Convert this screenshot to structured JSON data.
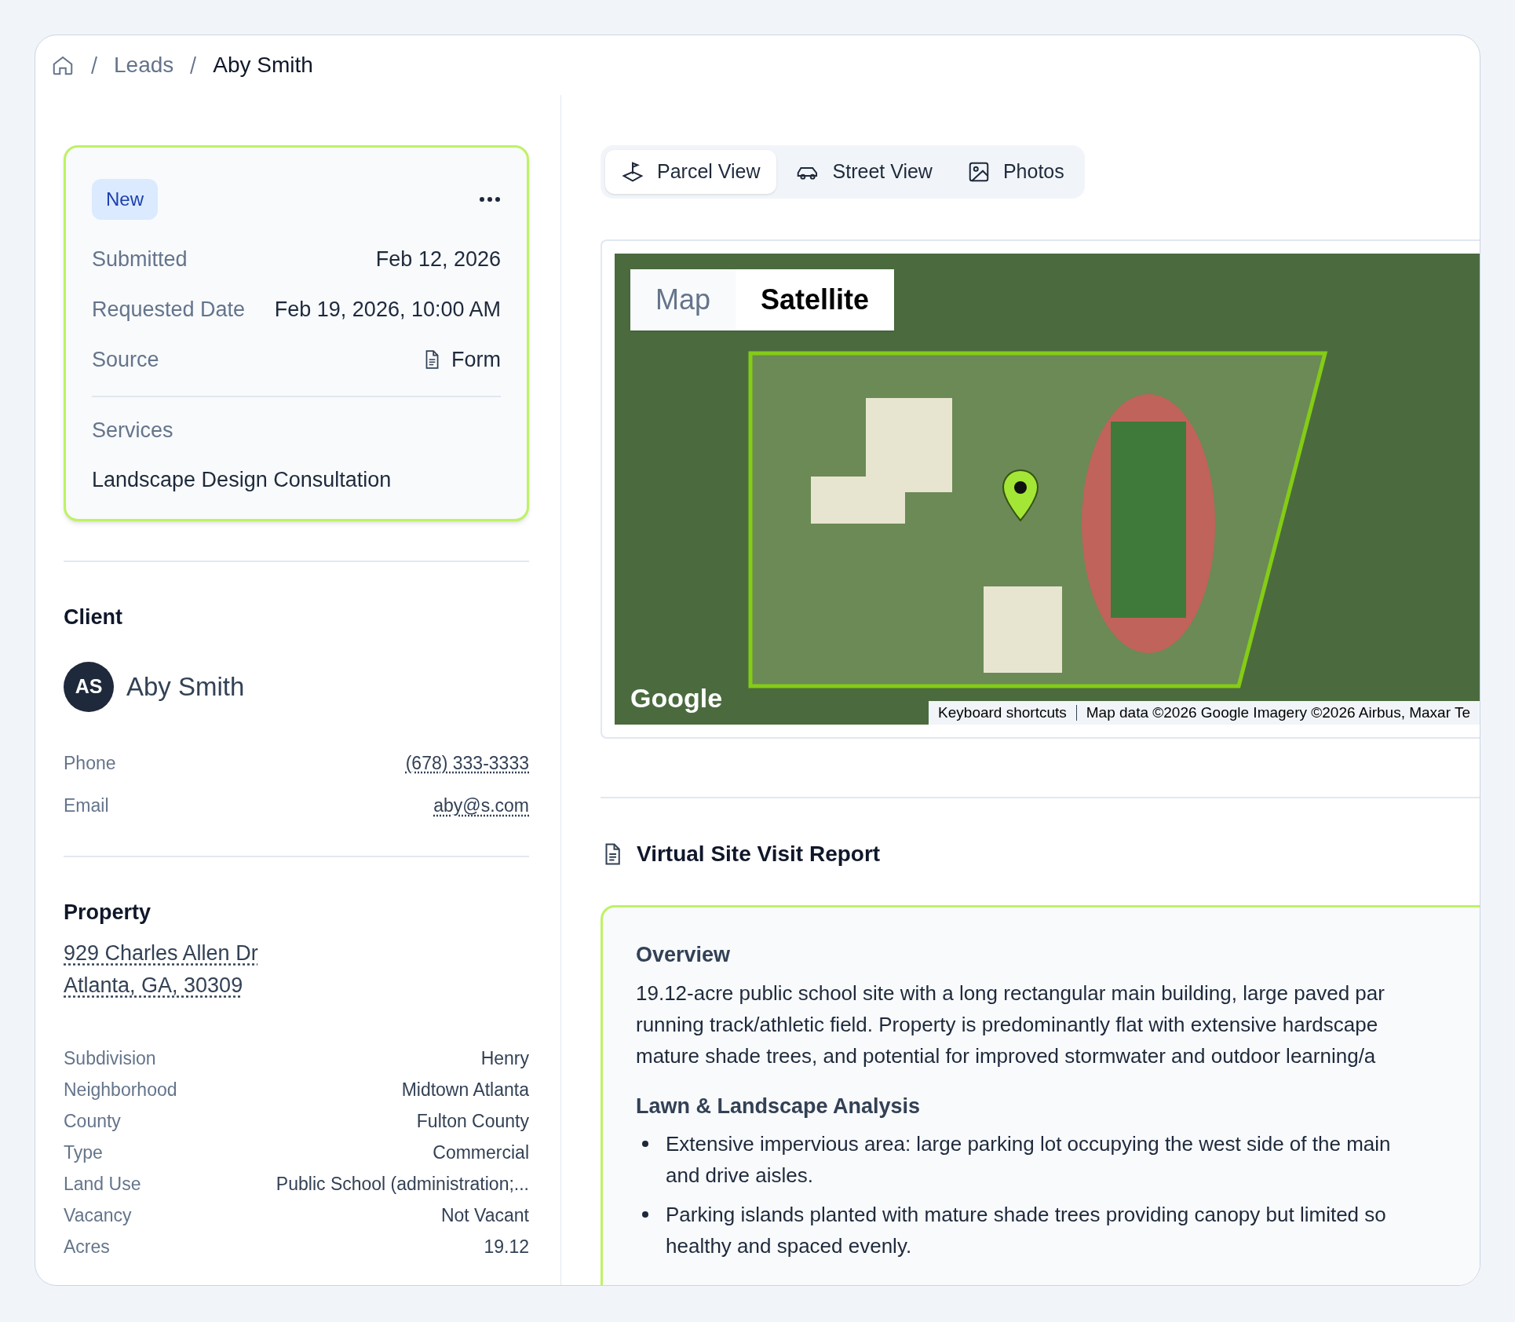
{
  "breadcrumb": {
    "items": [
      {
        "label": "Leads",
        "selected": false
      },
      {
        "label": "Aby Smith",
        "selected": true
      }
    ]
  },
  "lead_card": {
    "status": "New",
    "rows": [
      {
        "label": "Submitted",
        "value": "Feb 12, 2026",
        "kind": "text"
      },
      {
        "label": "Requested Date",
        "value": "Feb 19, 2026, 10:00 AM",
        "kind": "text"
      },
      {
        "label": "Source",
        "value": "Form",
        "kind": "document"
      }
    ],
    "services_label": "Services",
    "services": "Landscape Design Consultation"
  },
  "client": {
    "heading": "Client",
    "initials": "AS",
    "name": "Aby Smith",
    "rows": [
      {
        "label": "Phone",
        "value": "(678) 333-3333"
      },
      {
        "label": "Email",
        "value": "aby@s.com"
      }
    ]
  },
  "property": {
    "heading": "Property",
    "address_lines": [
      "929 Charles Allen Dr",
      "Atlanta, GA, 30309"
    ],
    "rows": [
      {
        "label": "Subdivision",
        "value": "Henry"
      },
      {
        "label": "Neighborhood",
        "value": "Midtown Atlanta"
      },
      {
        "label": "County",
        "value": "Fulton County"
      },
      {
        "label": "Type",
        "value": "Commercial"
      },
      {
        "label": "Land Use",
        "value": "Public School (administration;..."
      },
      {
        "label": "Vacancy",
        "value": "Not Vacant"
      },
      {
        "label": "Acres",
        "value": "19.12"
      }
    ]
  },
  "view_tabs": [
    {
      "label": "Parcel View",
      "kind": "parcel",
      "selected": true
    },
    {
      "label": "Street View",
      "kind": "car",
      "selected": false
    },
    {
      "label": "Photos",
      "kind": "image",
      "selected": false
    }
  ],
  "map": {
    "type_toggle": [
      {
        "label": "Map",
        "selected": false
      },
      {
        "label": "Satellite",
        "selected": true
      }
    ],
    "logo": "Google",
    "attribution": [
      "Keyboard shortcuts",
      "Map data ©2026 Google Imagery ©2026 Airbus, Maxar Te"
    ]
  },
  "report": {
    "title": "Virtual Site Visit Report",
    "sections": [
      {
        "heading": "Overview",
        "kind": "paragraph",
        "lines": [
          "19.12-acre public school site with a long rectangular main building, large paved par",
          "running track/athletic field. Property is predominantly flat with extensive hardscape",
          "mature shade trees, and potential for improved stormwater and outdoor learning/a"
        ]
      },
      {
        "heading": "Lawn & Landscape Analysis",
        "kind": "bullets",
        "items": [
          [
            "Extensive impervious area: large parking lot occupying the west side of the main",
            "and drive aisles."
          ],
          [
            "Parking islands planted with mature shade trees providing canopy but limited so",
            "healthy and spaced evenly."
          ]
        ]
      }
    ]
  }
}
